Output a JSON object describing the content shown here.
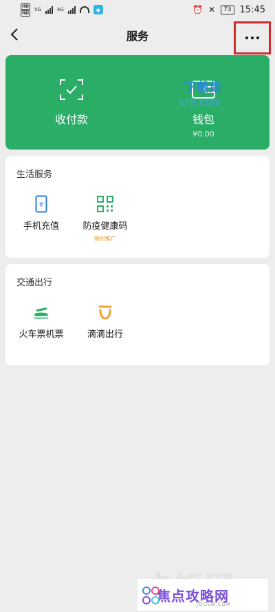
{
  "status_bar": {
    "network_hd": [
      "HD",
      "HD"
    ],
    "network_5g": "5G",
    "network_4g": "4G",
    "battery": "73",
    "time": "15:45"
  },
  "nav": {
    "title": "服务",
    "back_icon": "chevron-left-icon",
    "more_icon": "more-dots-icon",
    "highlight_color": "#d12b2b"
  },
  "pay_card": {
    "bg_color": "#2aae67",
    "receive_pay_label": "收付款",
    "wallet_label": "钱包",
    "wallet_balance": "¥0.00"
  },
  "life_services": {
    "title": "生活服务",
    "items": [
      {
        "label": "手机充值",
        "icon": "phone-yuan-icon",
        "tag": ""
      },
      {
        "label": "防疫健康码",
        "icon": "qr-code-icon",
        "tag": "限时推广"
      }
    ]
  },
  "transport": {
    "title": "交通出行",
    "items": [
      {
        "label": "火车票机票",
        "icon": "train-icon"
      },
      {
        "label": "滴滴出行",
        "icon": "didi-icon"
      }
    ]
  },
  "watermarks": {
    "top_title": "下载集",
    "top_domain": "xzji.com",
    "bottom_bg": "卡饭网",
    "bottom_text": "焦点攻略网",
    "bottom_sub": "JDGLW.COM"
  }
}
